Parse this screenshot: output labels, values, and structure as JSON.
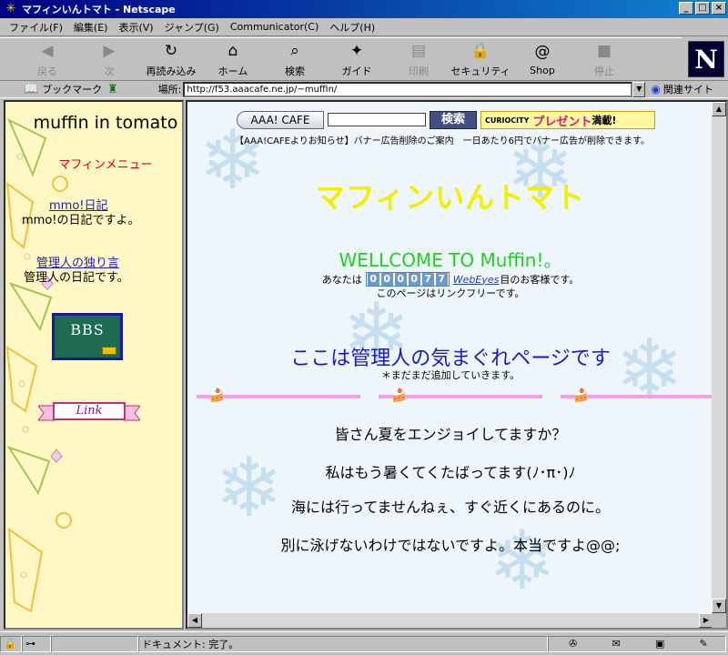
{
  "window": {
    "title": "マフィンいんトマト - Netscape",
    "buttons": {
      "minimize": "_",
      "maximize": "□",
      "close": "×"
    }
  },
  "menu": [
    "ファイル(F)",
    "編集(E)",
    "表示(V)",
    "ジャンプ(G)",
    "Communicator(C)",
    "ヘルプ(H)"
  ],
  "toolbar": [
    {
      "label": "戻る",
      "icon": "back-arrow-icon",
      "glyph": "◀",
      "disabled": true
    },
    {
      "label": "次",
      "icon": "forward-arrow-icon",
      "glyph": "▶",
      "disabled": true
    },
    {
      "label": "再読み込み",
      "icon": "reload-icon",
      "glyph": "↻",
      "disabled": false
    },
    {
      "label": "ホーム",
      "icon": "home-icon",
      "glyph": "⌂",
      "disabled": false
    },
    {
      "label": "検索",
      "icon": "search-icon",
      "glyph": "⌕",
      "disabled": false
    },
    {
      "label": "ガイド",
      "icon": "guide-icon",
      "glyph": "✦",
      "disabled": false
    },
    {
      "label": "印刷",
      "icon": "print-icon",
      "glyph": "▤",
      "disabled": true
    },
    {
      "label": "セキュリティ",
      "icon": "lock-icon",
      "glyph": "🔒",
      "disabled": false
    },
    {
      "label": "Shop",
      "icon": "shop-icon",
      "glyph": "@",
      "disabled": false
    },
    {
      "label": "停止",
      "icon": "stop-icon",
      "glyph": "■",
      "disabled": true
    }
  ],
  "logo": "N",
  "location": {
    "bookmarks_label": "ブックマーク",
    "location_label": "場所:",
    "url": "http://f53.aaacafe.ne.jp/~muffin/",
    "related_label": "関連サイト"
  },
  "left_frame": {
    "title": "muffin in tomato",
    "menu_heading": "マフィンメニュー",
    "items": [
      {
        "link": "mmo!日記",
        "desc": "mmo!の日記ですよ。"
      },
      {
        "link": "管理人の独り言",
        "desc": "管理人の日記です。"
      }
    ],
    "bbs_label": "BBS",
    "link_banner": "Link"
  },
  "right_frame": {
    "ad": {
      "brand": "AAA! CAFE",
      "search_button": "検索",
      "curio": "CURIOCITY",
      "present": "プレゼント",
      "present_suffix": "満載!",
      "notice": "【AAA!CAFEよりお知らせ】バナー広告削除のご案内　一日あたり6円でバナー広告が削除できます。"
    },
    "site_title": "マフィンいんトマト",
    "welcome": "WELLCOME TO Muffin!。",
    "counter_prefix": "あなたは",
    "counter_digits": [
      "0",
      "0",
      "0",
      "0",
      "7",
      "7"
    ],
    "counter_link": "WebEyes",
    "counter_suffix": "目のお客様です。",
    "link_free": "このページはリンクフリーです。",
    "headline": "ここは管理人の気まぐれページです",
    "subnote": "＊まだまだ追加していきます。",
    "messages": [
      "皆さん夏をエンジョイしてますか？",
      "私はもう暑くてくたばってます(ﾉ･π･)ﾉ",
      "海には行ってませんねぇ、すぐ近くにあるのに。",
      "別に泳げないわけではないですよ。本当ですよ@@;"
    ]
  },
  "status": {
    "text": "ドキュメント: 完了。"
  }
}
